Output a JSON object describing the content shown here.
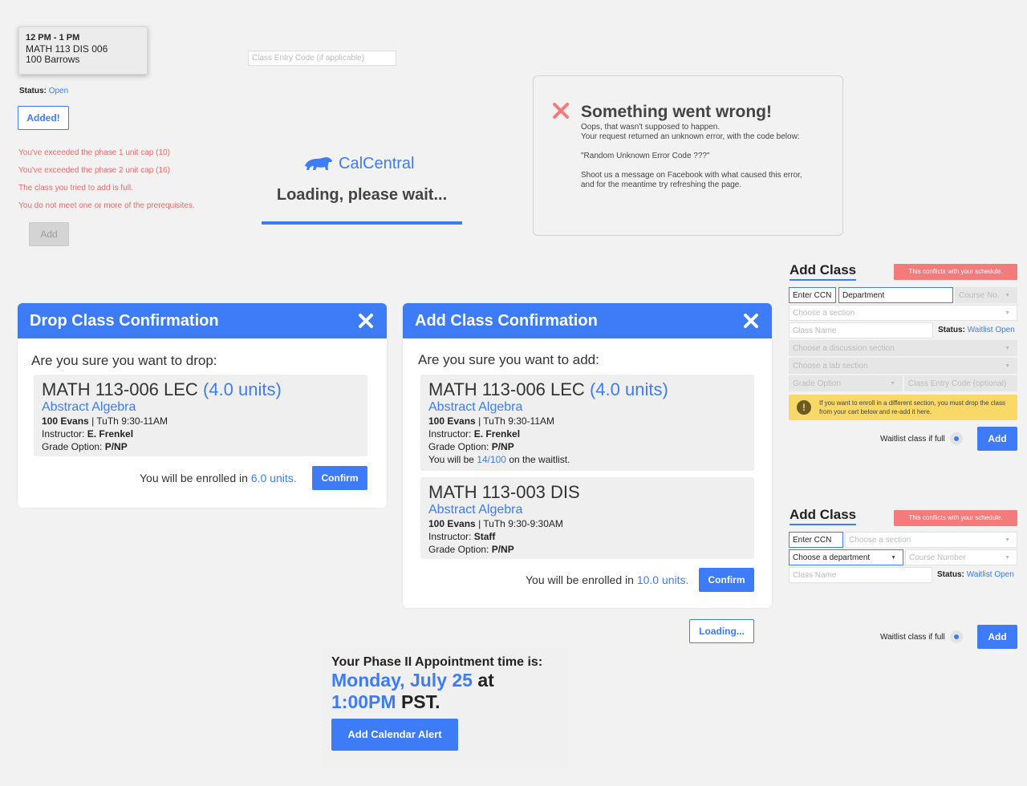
{
  "tooltip": {
    "time": "12 PM - 1 PM",
    "course": "MATH 113 DIS 006",
    "location": "100 Barrows"
  },
  "status": {
    "label": "Status:",
    "value": "Open"
  },
  "added_button": "Added!",
  "errors": [
    "You've exceeded the phase 1 unit cap (10)",
    "You've exceeded the phase 2 unit cap (16)",
    "The class you tried to add is full.",
    "You do not meet one or more of the prerequisites."
  ],
  "add_disabled_label": "Add",
  "entry_code_placeholder": "Class Entry Code (if applicable)",
  "loading": {
    "brand": "CalCentral",
    "text": "Loading, please wait..."
  },
  "error_box": {
    "title": "Something went wrong!",
    "line1": "Oops, that wasn't supposed to happen.",
    "line2": "Your request returned an unknown error, with the code below:",
    "code": "\"Random Unknown Error Code ???\"",
    "line3": "Shoot us a message on Facebook with what caused this error,",
    "line4": "and for the meantime try refreshing the page."
  },
  "drop_modal": {
    "title": "Drop Class Confirmation",
    "question": "Are you sure you want to drop:",
    "course": {
      "code": "MATH 113-006 LEC",
      "units": "(4.0 units)",
      "name": "Abstract Algebra",
      "room": "100 Evans",
      "time": "| TuTh 9:30-11AM",
      "instructor_label": "Instructor:",
      "instructor": "E. Frenkel",
      "grade_label": "Grade Option:",
      "grade": "P/NP"
    },
    "enroll_prefix": "You will be enrolled in",
    "enroll_units": "6.0 units.",
    "confirm": "Confirm"
  },
  "add_modal": {
    "title": "Add Class Confirmation",
    "question": "Are you sure you want to add:",
    "course1": {
      "code": "MATH 113-006 LEC",
      "units": "(4.0 units)",
      "name": "Abstract Algebra",
      "room": "100 Evans",
      "time": "| TuTh 9:30-11AM",
      "instructor_label": "Instructor:",
      "instructor": "E. Frenkel",
      "grade_label": "Grade Option:",
      "grade": "P/NP",
      "waitlist_prefix": "You will be",
      "waitlist_pos": "14/100",
      "waitlist_suffix": "on the waitlist."
    },
    "course2": {
      "code": "MATH 113-003 DIS",
      "name": "Abstract Algebra",
      "room": "100 Evans",
      "time": "| TuTh 9:30-9:30AM",
      "instructor_label": "Instructor:",
      "instructor": "Staff",
      "grade_label": "Grade Option:",
      "grade": "P/NP"
    },
    "enroll_prefix": "You will be enrolled in",
    "enroll_units": "10.0 units.",
    "confirm": "Confirm"
  },
  "loading_button": "Loading...",
  "appointment": {
    "heading": "Your Phase II Appointment time is:",
    "date": "Monday, July 25",
    "at": "at",
    "time": "1:00PM",
    "tz": "PST.",
    "button": "Add Calendar Alert"
  },
  "add_class_1": {
    "title": "Add Class",
    "conflict": "This conflicts with your schedule.",
    "ccn": "Enter CCN",
    "department": "Department",
    "course_no": "Course No.",
    "section": "Choose a section",
    "class_name": "Class Name",
    "status_label": "Status:",
    "status_value": "Waitlist Open",
    "discussion": "Choose a discussion section",
    "lab": "Choose a lab section",
    "grade": "Grade Option",
    "entry_code": "Class Entry Code (optional)",
    "warning": "If you want to enroll in a different section, you must drop the class from your cart below and re-add it here.",
    "waitlist_label": "Waitlist class if full",
    "add": "Add"
  },
  "add_class_2": {
    "title": "Add Class",
    "conflict": "This conflicts with your schedule.",
    "ccn": "Enter CCN",
    "section": "Choose a section",
    "department": "Choose a department",
    "course_number": "Course Number",
    "class_name": "Class Name",
    "status_label": "Status:",
    "status_value": "Waitlist Open",
    "waitlist_label": "Waitlist class if full",
    "add": "Add"
  },
  "colors": {
    "accent": "#3d7bf7",
    "error": "#ef6a6a",
    "warning": "#f8d867",
    "conflict": "#f47b7b"
  }
}
